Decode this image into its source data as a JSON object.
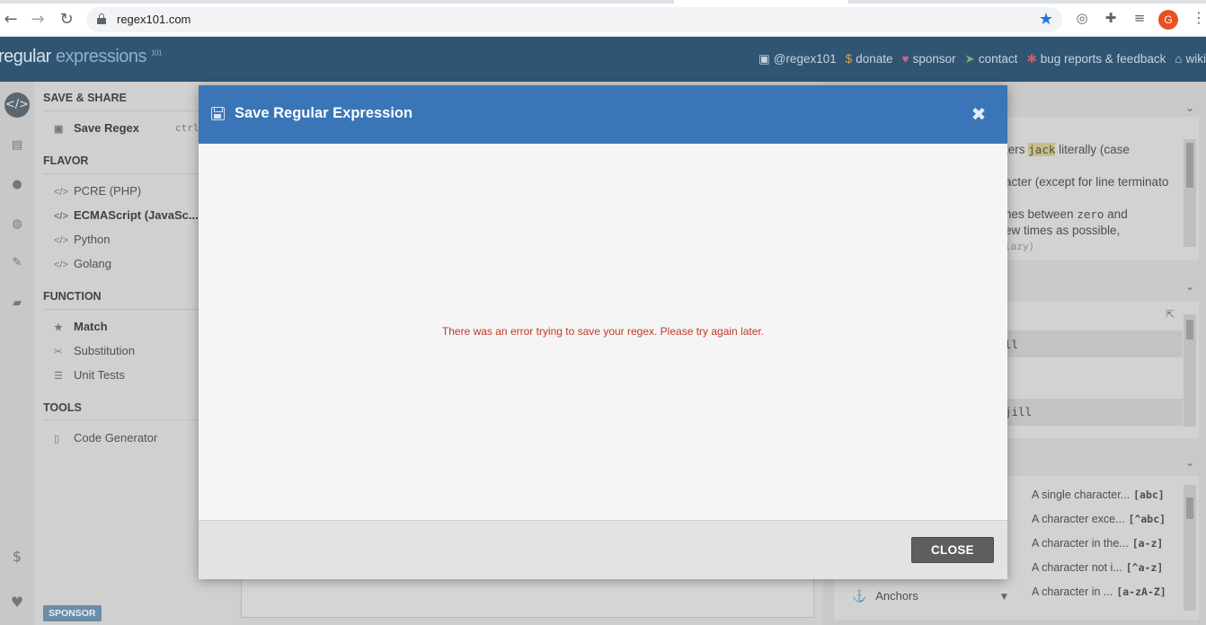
{
  "browser": {
    "url": "regex101.com",
    "back_label": "←",
    "forward_label": "→",
    "reload_label": "↻",
    "profile_initial": "G"
  },
  "site": {
    "logo_main": "regular",
    "logo_light": " expressions",
    "logo_version": "101",
    "header_links": [
      {
        "icon": "twitter-icon",
        "label": "@regex101"
      },
      {
        "icon": "dollar-icon",
        "label": "donate"
      },
      {
        "icon": "heart-icon",
        "label": "sponsor"
      },
      {
        "icon": "paper-plane-icon",
        "label": "contact"
      },
      {
        "icon": "bug-icon",
        "label": "bug reports & feedback"
      },
      {
        "icon": "bank-icon",
        "label": "wiki"
      }
    ]
  },
  "sidebar": {
    "save_share_heading": "SAVE & SHARE",
    "save_regex_label": "Save Regex",
    "save_regex_shortcut": "ctrl",
    "flavor_heading": "FLAVOR",
    "flavors": [
      "PCRE (PHP)",
      "ECMAScript (JavaSc...",
      "Python",
      "Golang"
    ],
    "function_heading": "FUNCTION",
    "functions": [
      "Match",
      "Substitution",
      "Unit Tests"
    ],
    "tools_heading": "TOOLS",
    "tools": [
      "Code Generator"
    ],
    "sponsor_badge": "SPONSOR"
  },
  "explanation": {
    "line1_pre": "ters ",
    "line1_code": "jack",
    "line1_post": " literally (case",
    "line2": "acter (except for line terminato",
    "line3_pre": "hes between ",
    "line3_code": "zero",
    "line3_post": " and",
    "line4": "ew times as possible,",
    "line5": "lazy)"
  },
  "match_info": {
    "row1": "ll",
    "row2": "jill"
  },
  "quick_reference": {
    "rows": [
      {
        "label": "A single character...",
        "code": "[abc]"
      },
      {
        "label": "A character exce...",
        "code": "[^abc]"
      },
      {
        "label": "A character in the...",
        "code": "[a-z]"
      },
      {
        "label": "A character not i...",
        "code": "[^a-z]"
      },
      {
        "label": "A character in ...",
        "code": "[a-zA-Z]"
      }
    ],
    "anchors_label": "Anchors"
  },
  "modal": {
    "title": "Save Regular Expression",
    "close_x": "✖",
    "error_message": "There was an error trying to save your regex. Please try again later.",
    "close_button": "CLOSE",
    "header_color": "#3a75b7",
    "error_color": "#c0392b"
  }
}
